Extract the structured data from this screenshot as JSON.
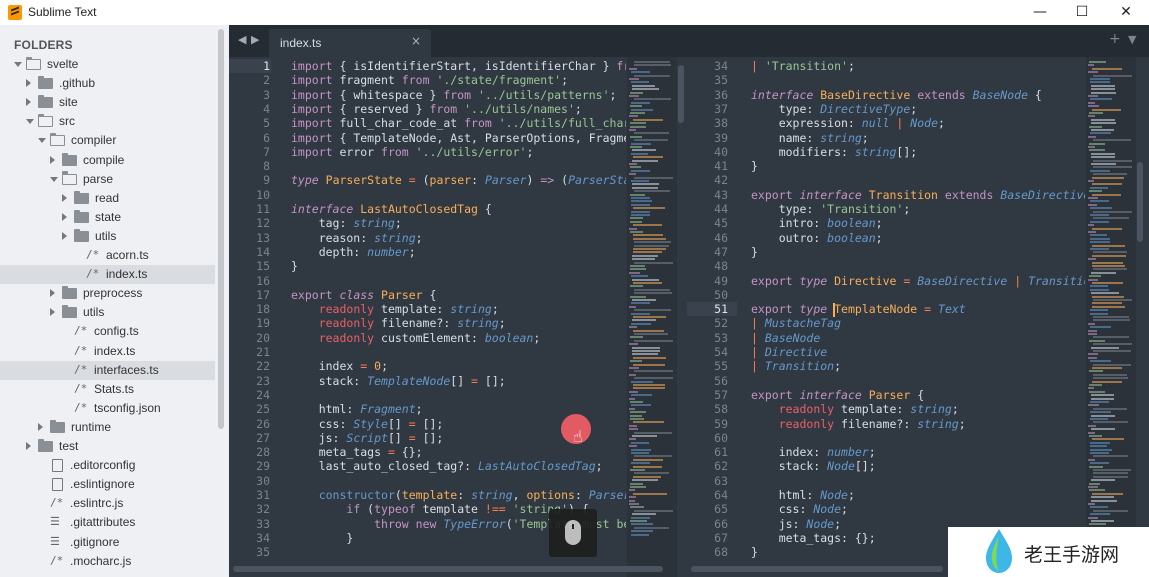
{
  "window": {
    "title": "Sublime Text",
    "minimize": "—",
    "maximize": "☐",
    "close": "✕"
  },
  "sidebar": {
    "header": "FOLDERS",
    "items": [
      {
        "label": "svelte",
        "kind": "folder",
        "open": true,
        "depth": 0
      },
      {
        "label": ".github",
        "kind": "folder",
        "open": false,
        "depth": 1
      },
      {
        "label": "site",
        "kind": "folder",
        "open": false,
        "depth": 1
      },
      {
        "label": "src",
        "kind": "folder",
        "open": true,
        "depth": 1
      },
      {
        "label": "compiler",
        "kind": "folder",
        "open": true,
        "depth": 2
      },
      {
        "label": "compile",
        "kind": "folder",
        "open": false,
        "depth": 3
      },
      {
        "label": "parse",
        "kind": "folder",
        "open": true,
        "depth": 3
      },
      {
        "label": "read",
        "kind": "folder",
        "open": false,
        "depth": 4
      },
      {
        "label": "state",
        "kind": "folder",
        "open": false,
        "depth": 4
      },
      {
        "label": "utils",
        "kind": "folder",
        "open": false,
        "depth": 4
      },
      {
        "label": "acorn.ts",
        "kind": "ts",
        "depth": 4
      },
      {
        "label": "index.ts",
        "kind": "ts",
        "depth": 4,
        "selected": true
      },
      {
        "label": "preprocess",
        "kind": "folder",
        "open": false,
        "depth": 3
      },
      {
        "label": "utils",
        "kind": "folder",
        "open": false,
        "depth": 3
      },
      {
        "label": "config.ts",
        "kind": "ts",
        "depth": 3
      },
      {
        "label": "index.ts",
        "kind": "ts",
        "depth": 3
      },
      {
        "label": "interfaces.ts",
        "kind": "ts",
        "depth": 3,
        "selected": true
      },
      {
        "label": "Stats.ts",
        "kind": "ts",
        "depth": 3
      },
      {
        "label": "tsconfig.json",
        "kind": "ts",
        "depth": 3
      },
      {
        "label": "runtime",
        "kind": "folder",
        "open": false,
        "depth": 2
      },
      {
        "label": "test",
        "kind": "folder",
        "open": false,
        "depth": 1
      },
      {
        "label": ".editorconfig",
        "kind": "file",
        "depth": 1
      },
      {
        "label": ".eslintignore",
        "kind": "file",
        "depth": 1
      },
      {
        "label": ".eslintrc.js",
        "kind": "ts",
        "depth": 1
      },
      {
        "label": ".gitattributes",
        "kind": "lines",
        "depth": 1
      },
      {
        "label": ".gitignore",
        "kind": "lines",
        "depth": 1
      },
      {
        "label": ".mocharc.js",
        "kind": "ts",
        "depth": 1
      }
    ]
  },
  "tabs": {
    "prev": "◀",
    "next": "▶",
    "active": "index.ts",
    "close": "×",
    "new_tab": "+",
    "menu": "▼"
  },
  "left_pane": {
    "current_line": 1,
    "lines": [
      [
        [
          "kw",
          "import"
        ],
        [
          "plain",
          " { isIdentifierStart, isIdentifierChar } "
        ],
        [
          "kw",
          "fr"
        ]
      ],
      [
        [
          "kw",
          "import"
        ],
        [
          "plain",
          " fragment "
        ],
        [
          "kw",
          "from"
        ],
        [
          "plain",
          " "
        ],
        [
          "str",
          "'./state/fragment'"
        ],
        [
          "plain",
          ";"
        ]
      ],
      [
        [
          "kw",
          "import"
        ],
        [
          "plain",
          " { whitespace } "
        ],
        [
          "kw",
          "from"
        ],
        [
          "plain",
          " "
        ],
        [
          "str",
          "'../utils/patterns'"
        ],
        [
          "plain",
          ";"
        ]
      ],
      [
        [
          "kw",
          "import"
        ],
        [
          "plain",
          " { reserved } "
        ],
        [
          "kw",
          "from"
        ],
        [
          "plain",
          " "
        ],
        [
          "str",
          "'../utils/names'"
        ],
        [
          "plain",
          ";"
        ]
      ],
      [
        [
          "kw",
          "import"
        ],
        [
          "plain",
          " full_char_code_at "
        ],
        [
          "kw",
          "from"
        ],
        [
          "plain",
          " "
        ],
        [
          "str",
          "'../utils/full_char"
        ]
      ],
      [
        [
          "kw",
          "import"
        ],
        [
          "plain",
          " { TemplateNode, Ast, ParserOptions, Fragmen"
        ]
      ],
      [
        [
          "kw",
          "import"
        ],
        [
          "plain",
          " error "
        ],
        [
          "kw",
          "from"
        ],
        [
          "plain",
          " "
        ],
        [
          "str",
          "'../utils/error'"
        ],
        [
          "plain",
          ";"
        ]
      ],
      [],
      [
        [
          "kwi",
          "type"
        ],
        [
          "plain",
          " "
        ],
        [
          "cls",
          "ParserState"
        ],
        [
          "plain",
          " "
        ],
        [
          "op",
          "="
        ],
        [
          "plain",
          " ("
        ],
        [
          "cls",
          "parser"
        ],
        [
          "plain",
          ": "
        ],
        [
          "typ",
          "Parser"
        ],
        [
          "plain",
          ") "
        ],
        [
          "kw",
          "=>"
        ],
        [
          "plain",
          " ("
        ],
        [
          "typ",
          "ParserSta"
        ]
      ],
      [],
      [
        [
          "kwi",
          "interface"
        ],
        [
          "plain",
          " "
        ],
        [
          "cls",
          "LastAutoClosedTag"
        ],
        [
          "plain",
          " {"
        ]
      ],
      [
        [
          "plain",
          "    tag: "
        ],
        [
          "typ",
          "string"
        ],
        [
          "plain",
          ";"
        ]
      ],
      [
        [
          "plain",
          "    reason: "
        ],
        [
          "typ",
          "string"
        ],
        [
          "plain",
          ";"
        ]
      ],
      [
        [
          "plain",
          "    depth: "
        ],
        [
          "typ",
          "number"
        ],
        [
          "plain",
          ";"
        ]
      ],
      [
        [
          "plain",
          "}"
        ]
      ],
      [],
      [
        [
          "kw",
          "export"
        ],
        [
          "plain",
          " "
        ],
        [
          "kwi",
          "class"
        ],
        [
          "plain",
          " "
        ],
        [
          "cls",
          "Parser"
        ],
        [
          "plain",
          " {"
        ]
      ],
      [
        [
          "plain",
          "    "
        ],
        [
          "red",
          "readonly"
        ],
        [
          "plain",
          " template: "
        ],
        [
          "typ",
          "string"
        ],
        [
          "plain",
          ";"
        ]
      ],
      [
        [
          "plain",
          "    "
        ],
        [
          "red",
          "readonly"
        ],
        [
          "plain",
          " filename?: "
        ],
        [
          "typ",
          "string"
        ],
        [
          "plain",
          ";"
        ]
      ],
      [
        [
          "plain",
          "    "
        ],
        [
          "red",
          "readonly"
        ],
        [
          "plain",
          " customElement: "
        ],
        [
          "typ",
          "boolean"
        ],
        [
          "plain",
          ";"
        ]
      ],
      [],
      [
        [
          "plain",
          "    index "
        ],
        [
          "op",
          "="
        ],
        [
          "plain",
          " "
        ],
        [
          "num",
          "0"
        ],
        [
          "plain",
          ";"
        ]
      ],
      [
        [
          "plain",
          "    stack: "
        ],
        [
          "typ",
          "TemplateNode"
        ],
        [
          "plain",
          "[] "
        ],
        [
          "op",
          "="
        ],
        [
          "plain",
          " [];"
        ]
      ],
      [],
      [
        [
          "plain",
          "    html: "
        ],
        [
          "typ",
          "Fragment"
        ],
        [
          "plain",
          ";"
        ]
      ],
      [
        [
          "plain",
          "    css: "
        ],
        [
          "typ",
          "Style"
        ],
        [
          "plain",
          "[] "
        ],
        [
          "op",
          "="
        ],
        [
          "plain",
          " [];"
        ]
      ],
      [
        [
          "plain",
          "    js: "
        ],
        [
          "typ",
          "Script"
        ],
        [
          "plain",
          "[] "
        ],
        [
          "op",
          "="
        ],
        [
          "plain",
          " [];"
        ]
      ],
      [
        [
          "plain",
          "    meta_tags "
        ],
        [
          "op",
          "="
        ],
        [
          "plain",
          " {};"
        ]
      ],
      [
        [
          "plain",
          "    last_auto_closed_tag?: "
        ],
        [
          "typ",
          "LastAutoClosedTag"
        ],
        [
          "plain",
          ";"
        ]
      ],
      [],
      [
        [
          "plain",
          "    "
        ],
        [
          "fn",
          "constructor"
        ],
        [
          "plain",
          "("
        ],
        [
          "cls",
          "template"
        ],
        [
          "plain",
          ": "
        ],
        [
          "typ",
          "string"
        ],
        [
          "plain",
          ", "
        ],
        [
          "cls",
          "options"
        ],
        [
          "plain",
          ": "
        ],
        [
          "typ",
          "Parser"
        ]
      ],
      [
        [
          "plain",
          "        "
        ],
        [
          "kw",
          "if"
        ],
        [
          "plain",
          " ("
        ],
        [
          "kw",
          "typeof"
        ],
        [
          "plain",
          " template "
        ],
        [
          "op",
          "!=="
        ],
        [
          "plain",
          " "
        ],
        [
          "str",
          "'string'"
        ],
        [
          "plain",
          ") {"
        ]
      ],
      [
        [
          "plain",
          "            "
        ],
        [
          "kw",
          "throw"
        ],
        [
          "plain",
          " "
        ],
        [
          "kw",
          "new"
        ],
        [
          "plain",
          " "
        ],
        [
          "typ",
          "TypeError"
        ],
        [
          "plain",
          "("
        ],
        [
          "str",
          "'Template must be"
        ]
      ],
      [
        [
          "plain",
          "        }"
        ]
      ],
      []
    ]
  },
  "right_pane": {
    "first_line": 34,
    "current_line": 51,
    "lines": [
      [
        [
          "op",
          "|"
        ],
        [
          "plain",
          " "
        ],
        [
          "str",
          "'Transition'"
        ],
        [
          "plain",
          ";"
        ]
      ],
      [],
      [
        [
          "kwi",
          "interface"
        ],
        [
          "plain",
          " "
        ],
        [
          "cls",
          "BaseDirective"
        ],
        [
          "plain",
          " "
        ],
        [
          "kw",
          "extends"
        ],
        [
          "plain",
          " "
        ],
        [
          "typ",
          "BaseNode"
        ],
        [
          "plain",
          " {"
        ]
      ],
      [
        [
          "plain",
          "    type: "
        ],
        [
          "typ",
          "DirectiveType"
        ],
        [
          "plain",
          ";"
        ]
      ],
      [
        [
          "plain",
          "    expression: "
        ],
        [
          "typ",
          "null"
        ],
        [
          "plain",
          " "
        ],
        [
          "op",
          "|"
        ],
        [
          "plain",
          " "
        ],
        [
          "typ",
          "Node"
        ],
        [
          "plain",
          ";"
        ]
      ],
      [
        [
          "plain",
          "    name: "
        ],
        [
          "typ",
          "string"
        ],
        [
          "plain",
          ";"
        ]
      ],
      [
        [
          "plain",
          "    modifiers: "
        ],
        [
          "typ",
          "string"
        ],
        [
          "plain",
          "[];"
        ]
      ],
      [
        [
          "plain",
          "}"
        ]
      ],
      [],
      [
        [
          "kw",
          "export"
        ],
        [
          "plain",
          " "
        ],
        [
          "kwi",
          "interface"
        ],
        [
          "plain",
          " "
        ],
        [
          "cls",
          "Transition"
        ],
        [
          "plain",
          " "
        ],
        [
          "kw",
          "extends"
        ],
        [
          "plain",
          " "
        ],
        [
          "typ",
          "BaseDirective"
        ]
      ],
      [
        [
          "plain",
          "    type: "
        ],
        [
          "str",
          "'Transition'"
        ],
        [
          "plain",
          ";"
        ]
      ],
      [
        [
          "plain",
          "    intro: "
        ],
        [
          "typ",
          "boolean"
        ],
        [
          "plain",
          ";"
        ]
      ],
      [
        [
          "plain",
          "    outro: "
        ],
        [
          "typ",
          "boolean"
        ],
        [
          "plain",
          ";"
        ]
      ],
      [
        [
          "plain",
          "}"
        ]
      ],
      [],
      [
        [
          "kw",
          "export"
        ],
        [
          "plain",
          " "
        ],
        [
          "kwi",
          "type"
        ],
        [
          "plain",
          " "
        ],
        [
          "cls",
          "Directive"
        ],
        [
          "plain",
          " "
        ],
        [
          "op",
          "="
        ],
        [
          "plain",
          " "
        ],
        [
          "typ",
          "BaseDirective"
        ],
        [
          "plain",
          " "
        ],
        [
          "op",
          "|"
        ],
        [
          "plain",
          " "
        ],
        [
          "typ",
          "Transition"
        ]
      ],
      [],
      [
        [
          "kw",
          "export"
        ],
        [
          "plain",
          " "
        ],
        [
          "kwi",
          "type"
        ],
        [
          "plain",
          " "
        ],
        [
          "cls",
          "TemplateNode"
        ],
        [
          "plain",
          " "
        ],
        [
          "op",
          "="
        ],
        [
          "plain",
          " "
        ],
        [
          "typ",
          "Text"
        ]
      ],
      [
        [
          "op",
          "|"
        ],
        [
          "plain",
          " "
        ],
        [
          "typ",
          "MustacheTag"
        ]
      ],
      [
        [
          "op",
          "|"
        ],
        [
          "plain",
          " "
        ],
        [
          "typ",
          "BaseNode"
        ]
      ],
      [
        [
          "op",
          "|"
        ],
        [
          "plain",
          " "
        ],
        [
          "typ",
          "Directive"
        ]
      ],
      [
        [
          "op",
          "|"
        ],
        [
          "plain",
          " "
        ],
        [
          "typ",
          "Transition"
        ],
        [
          "plain",
          ";"
        ]
      ],
      [],
      [
        [
          "kw",
          "export"
        ],
        [
          "plain",
          " "
        ],
        [
          "kwi",
          "interface"
        ],
        [
          "plain",
          " "
        ],
        [
          "cls",
          "Parser"
        ],
        [
          "plain",
          " {"
        ]
      ],
      [
        [
          "plain",
          "    "
        ],
        [
          "red",
          "readonly"
        ],
        [
          "plain",
          " template: "
        ],
        [
          "typ",
          "string"
        ],
        [
          "plain",
          ";"
        ]
      ],
      [
        [
          "plain",
          "    "
        ],
        [
          "red",
          "readonly"
        ],
        [
          "plain",
          " filename?: "
        ],
        [
          "typ",
          "string"
        ],
        [
          "plain",
          ";"
        ]
      ],
      [],
      [
        [
          "plain",
          "    index: "
        ],
        [
          "typ",
          "number"
        ],
        [
          "plain",
          ";"
        ]
      ],
      [
        [
          "plain",
          "    stack: "
        ],
        [
          "typ",
          "Node"
        ],
        [
          "plain",
          "[];"
        ]
      ],
      [],
      [
        [
          "plain",
          "    html: "
        ],
        [
          "typ",
          "Node"
        ],
        [
          "plain",
          ";"
        ]
      ],
      [
        [
          "plain",
          "    css: "
        ],
        [
          "typ",
          "Node"
        ],
        [
          "plain",
          ";"
        ]
      ],
      [
        [
          "plain",
          "    js: "
        ],
        [
          "typ",
          "Node"
        ],
        [
          "plain",
          ";"
        ]
      ],
      [
        [
          "plain",
          "    meta_tags: {};"
        ]
      ],
      [
        [
          "plain",
          "}"
        ]
      ]
    ]
  },
  "colors": {
    "editor_bg": "#303841",
    "keyword": "#c594c5",
    "string": "#99c794",
    "type": "#6699cc",
    "class": "#f9ae58",
    "readonly": "#ec5f66"
  },
  "overlays": {
    "record_icon": "record-button-icon",
    "hand_cursor": "☝",
    "mouse_icon": "mouse-icon"
  },
  "watermark": {
    "text": "老王手游网"
  }
}
